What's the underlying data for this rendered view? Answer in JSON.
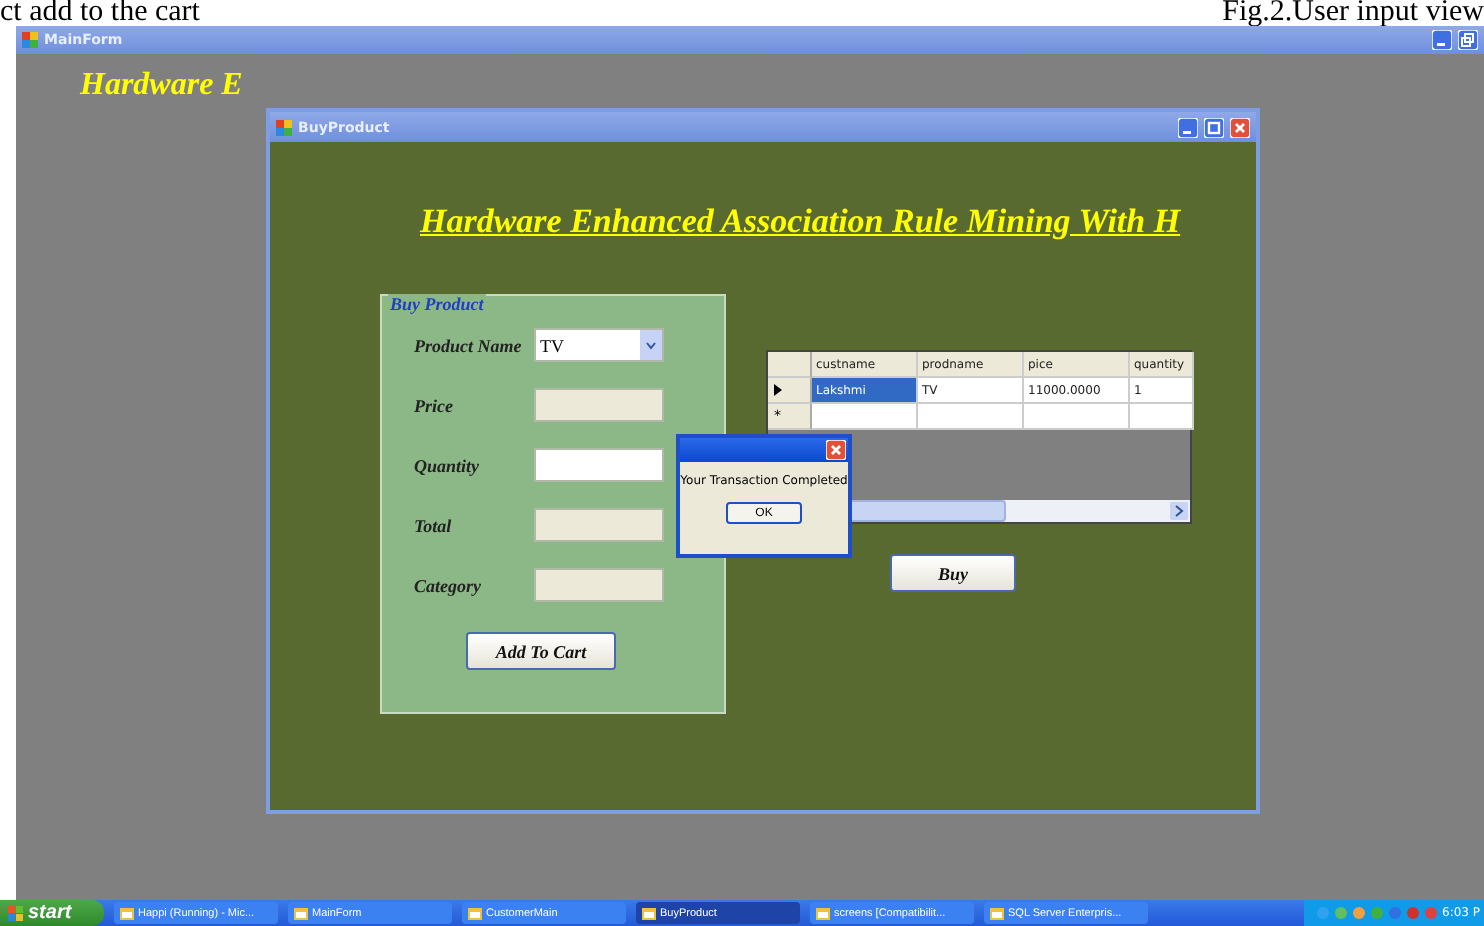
{
  "document": {
    "left_caption": "ct add to the cart",
    "right_caption": "Fig.2.User input view"
  },
  "main_window": {
    "title": "MainForm",
    "heading": "Hardware E"
  },
  "buy_window": {
    "title": "BuyProduct",
    "heading": "Hardware Enhanced Association Rule Mining With H",
    "group_title": "Buy Product",
    "fields": [
      {
        "label": "Product Name",
        "kind": "dropdown",
        "value": "TV",
        "disabled": false
      },
      {
        "label": "Price",
        "kind": "text",
        "disabled": true
      },
      {
        "label": "Quantity",
        "kind": "text",
        "disabled": false
      },
      {
        "label": "Total",
        "kind": "text",
        "disabled": true
      },
      {
        "label": "Category",
        "kind": "text",
        "disabled": true
      }
    ],
    "add_button": "Add To Cart",
    "buy_button": "Buy",
    "grid": {
      "columns": [
        "custname",
        "prodname",
        "pice",
        "quantity"
      ],
      "rows": [
        {
          "cells": [
            "Lakshmi",
            "TV",
            "11000.0000",
            "1"
          ],
          "selected": true
        }
      ],
      "new_row_marker": "*"
    },
    "dialog": {
      "message": "Your Transaction Completed",
      "button": "OK"
    }
  },
  "taskbar": {
    "start": "start",
    "items": [
      {
        "label": "Happi (Running) - Mic...",
        "selected": false
      },
      {
        "label": "MainForm",
        "selected": false
      },
      {
        "label": "CustomerMain",
        "selected": false
      },
      {
        "label": "BuyProduct",
        "selected": true
      },
      {
        "label": "screens [Compatibilit...",
        "selected": false
      },
      {
        "label": "SQL Server Enterpris...",
        "selected": false
      }
    ],
    "clock": "6:03 P"
  }
}
